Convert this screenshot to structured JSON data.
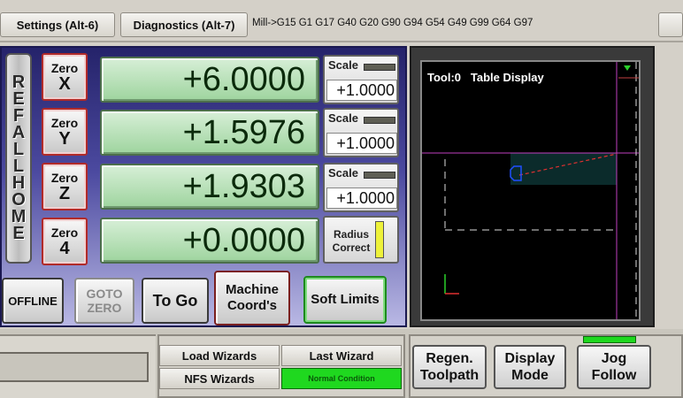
{
  "tabs": [
    "Settings (Alt-6)",
    "Diagnostics (Alt-7)"
  ],
  "gcode_status": "Mill->G15  G1 G17 G40 G20 G90 G94 G54 G49 G99 G64 G97",
  "ref_home_label": "REF ALL HOME",
  "axes": [
    {
      "zero_top": "Zero",
      "zero_axis": "X",
      "dro": "+6.0000",
      "scale_label": "Scale",
      "scale_value": "+1.0000"
    },
    {
      "zero_top": "Zero",
      "zero_axis": "Y",
      "dro": "+1.5976",
      "scale_label": "Scale",
      "scale_value": "+1.0000"
    },
    {
      "zero_top": "Zero",
      "zero_axis": "Z",
      "dro": "+1.9303",
      "scale_label": "Scale",
      "scale_value": "+1.0000"
    },
    {
      "zero_top": "Zero",
      "zero_axis": "4",
      "dro": "+0.0000"
    }
  ],
  "radius_correct_label": "Radius Correct",
  "buttons": {
    "offline": "OFFLINE",
    "goto_zero": "GOTO ZERO",
    "to_go": "To Go",
    "machine_coords": "Machine Coord's",
    "soft_limits": "Soft Limits"
  },
  "display": {
    "tool": "Tool:0",
    "title": "Table Display"
  },
  "wizards": {
    "load": "Load Wizards",
    "last": "Last Wizard",
    "nfs": "NFS Wizards",
    "status": "Normal Condition"
  },
  "toolpath_buttons": {
    "regen": "Regen. Toolpath",
    "display_mode": "Display Mode",
    "jog_follow": "Jog Follow"
  },
  "colors": {
    "dro_green": "#9ed49e",
    "led_green": "#1fd81f",
    "led_yellow": "#eef23a",
    "zero_border": "#b02a2a",
    "panel_blue": "#25236a"
  }
}
